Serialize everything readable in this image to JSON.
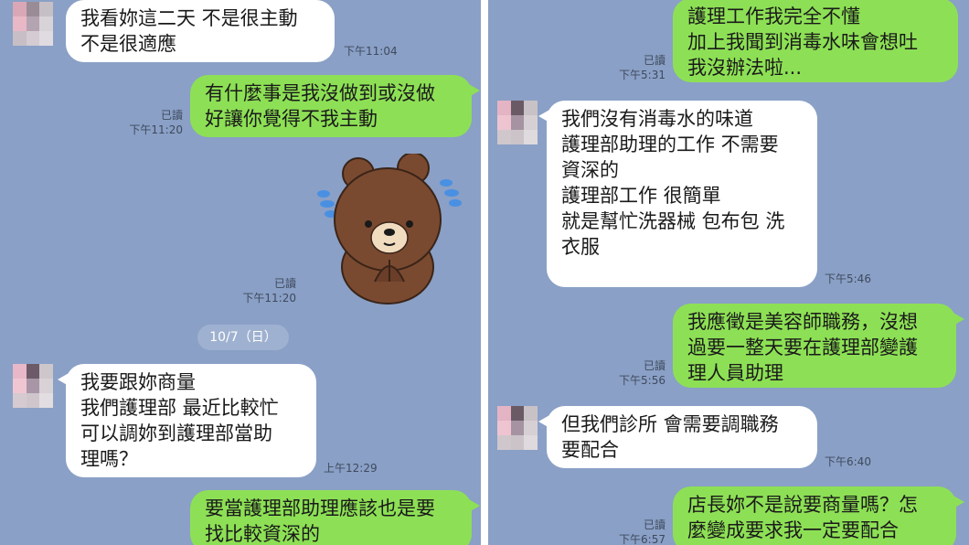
{
  "left": {
    "messages": [
      {
        "text": "我看妳這二天 不是很主動\n不是很適應",
        "time": "下午11:04"
      },
      {
        "text": "有什麼事是我沒做到或沒做\n好讓你覺得不我主動",
        "read": "已讀",
        "time": "下午11:20"
      },
      {
        "sticker": "brown-bear-pleading-sticker",
        "read": "已讀",
        "time": "下午11:20"
      },
      {
        "text": "我要跟妳商量\n我們護理部 最近比較忙\n可以調妳到護理部當助\n理嗎？",
        "time": "上午12:29"
      },
      {
        "text": "要當護理部助理應該也是要\n找比較資深的"
      }
    ],
    "date_separator": "10/7（日）"
  },
  "right": {
    "messages": [
      {
        "text": "護理工作我完全不懂\n加上我聞到消毒水味會想吐\n我沒辦法啦...",
        "read": "已讀",
        "time": "下午5:31"
      },
      {
        "text": "我們沒有消毒水的味道\n護理部助理的工作 不需要\n資深的\n護理部工作 很簡單\n就是幫忙洗器械 包布包 洗\n衣服",
        "time": "下午5:46"
      },
      {
        "text": "我應徵是美容師職務，沒想\n過要一整天要在護理部變護\n理人員助理",
        "read": "已讀",
        "time": "下午5:56"
      },
      {
        "text": "但我們診所 會需要調職務\n要配合",
        "time": "下午6:40"
      },
      {
        "text": "店長妳不是說要商量嗎？怎\n麼變成要求我一定要配合",
        "read": "已讀",
        "time": "下午6:57"
      }
    ]
  },
  "colors": {
    "background": "#8aa0c6",
    "incoming_bubble": "#ffffff",
    "outgoing_bubble": "#8de055"
  }
}
